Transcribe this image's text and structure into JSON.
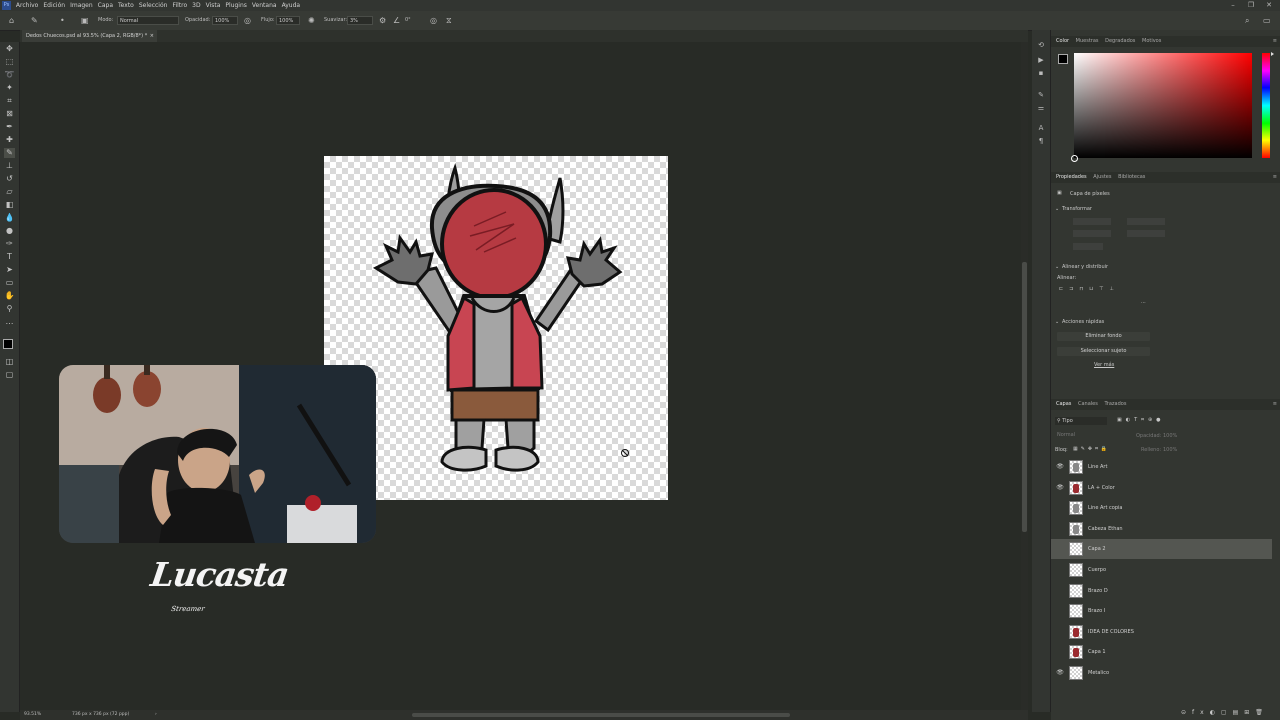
{
  "menubar": {
    "app_icon": "Ps",
    "items": [
      "Archivo",
      "Edición",
      "Imagen",
      "Capa",
      "Texto",
      "Selección",
      "Filtro",
      "3D",
      "Vista",
      "Plugins",
      "Ventana",
      "Ayuda"
    ]
  },
  "options_bar": {
    "mode_label": "Modo:",
    "mode_value": "Normal",
    "opacity_label": "Opacidad:",
    "opacity_value": "100%",
    "flow_label": "Flujo:",
    "flow_value": "100%",
    "smoothing_label": "Suavizar:",
    "smoothing_value": "3%",
    "angle_value": "0°"
  },
  "document": {
    "tab_title": "Dedos Chuecos.psd al 93.5% (Capa 2, RGB/8*) *",
    "status_zoom": "93.51%",
    "status_size": "736 px x 736 px (72 ppp)"
  },
  "stream": {
    "logo_text": "Lucasta",
    "logo_subtext": "Streamer"
  },
  "color_panel": {
    "tabs": [
      "Color",
      "Muestras",
      "Degradados",
      "Motivos"
    ],
    "active_tab": "Color",
    "hue_color": "#ff0000"
  },
  "properties_panel": {
    "tabs": [
      "Propiedades",
      "Ajustes",
      "Bibliotecas"
    ],
    "active_tab": "Propiedades",
    "layer_type": "Capa de píxeles",
    "transform_header": "Transformar",
    "align_header": "Alinear y distribuir",
    "align_label": "Alinear:",
    "quick_actions_header": "Acciones rápidas",
    "remove_bg_button": "Eliminar fondo",
    "select_subject_button": "Seleccionar sujeto",
    "more_link": "Ver más"
  },
  "layers_panel": {
    "tabs": [
      "Capas",
      "Canales",
      "Trazados"
    ],
    "active_tab": "Capas",
    "filter_label": "Tipo",
    "blend_mode": "Normal",
    "opacity_label": "Opacidad:",
    "opacity_value": "100%",
    "lock_label": "Bloq:",
    "fill_label": "Relleno:",
    "fill_value": "100%",
    "layers": [
      {
        "name": "Line Art",
        "visible": true,
        "thumb": "grey",
        "selected": false
      },
      {
        "name": "LA + Color",
        "visible": true,
        "thumb": "red",
        "selected": false
      },
      {
        "name": "Line Art copia",
        "visible": false,
        "thumb": "grey",
        "selected": false
      },
      {
        "name": "Cabeza Ethan",
        "visible": false,
        "thumb": "grey",
        "selected": false
      },
      {
        "name": "Capa 2",
        "visible": false,
        "thumb": "blank",
        "selected": true
      },
      {
        "name": "Cuerpo",
        "visible": false,
        "thumb": "blank",
        "selected": false
      },
      {
        "name": "Brazo D",
        "visible": false,
        "thumb": "blank",
        "selected": false
      },
      {
        "name": "Brazo I",
        "visible": false,
        "thumb": "blank",
        "selected": false
      },
      {
        "name": "IDEA DE COLORES",
        "visible": false,
        "thumb": "red",
        "selected": false
      },
      {
        "name": "Capa 1",
        "visible": false,
        "thumb": "red",
        "selected": false
      },
      {
        "name": "Metalico",
        "visible": true,
        "thumb": "blank",
        "selected": false
      }
    ]
  },
  "colors": {
    "accent_red": "#b63a42",
    "body_grey": "#9a9a9a",
    "shorts_brown": "#8a5a3c"
  }
}
